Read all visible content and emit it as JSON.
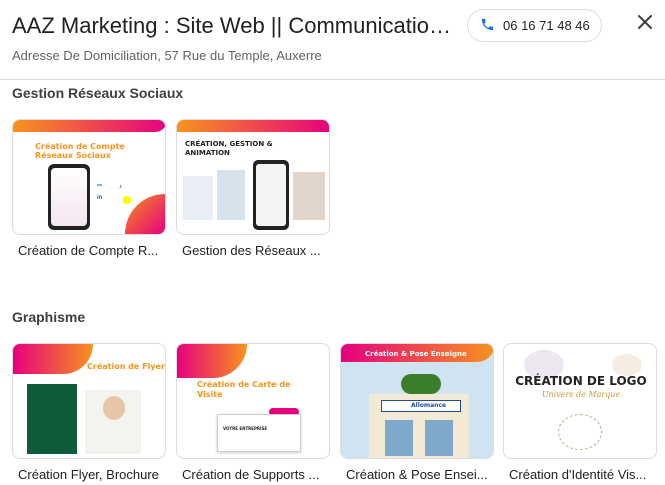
{
  "header": {
    "title": "AAZ Marketing : Site Web || Communication ...",
    "address": "Adresse De Domiciliation, 57 Rue du Temple, Auxerre",
    "phone": "06 16 71 48 46"
  },
  "sections": [
    {
      "title": "Gestion Réseaux Sociaux",
      "items": [
        {
          "label": "Création de Compte R...",
          "thumb_text": "Création de Compte Réseaux Sociaux"
        },
        {
          "label": "Gestion des Réseaux ...",
          "thumb_text": "CRÉATION, GESTION & ANIMATION"
        }
      ]
    },
    {
      "title": "Graphisme",
      "items": [
        {
          "label": "Création Flyer, Brochure",
          "thumb_text": "Création de Flyer"
        },
        {
          "label": "Création de Supports ...",
          "thumb_text": "Création de Carte de Visite",
          "card_badge": "VOTRE ENTREPRISE"
        },
        {
          "label": "Création & Pose Ensei...",
          "thumb_text": "Création & Pose Enseigne",
          "shop_sign": "Allomance"
        },
        {
          "label": "Création d'Identité Vis...",
          "thumb_text": "CRÉATION DE LOGO",
          "thumb_subtext": "Univers de Marque"
        }
      ]
    }
  ],
  "colors": {
    "accent_blue": "#1a73e8",
    "brand_orange": "#f7941d",
    "brand_pink": "#e6007e"
  }
}
